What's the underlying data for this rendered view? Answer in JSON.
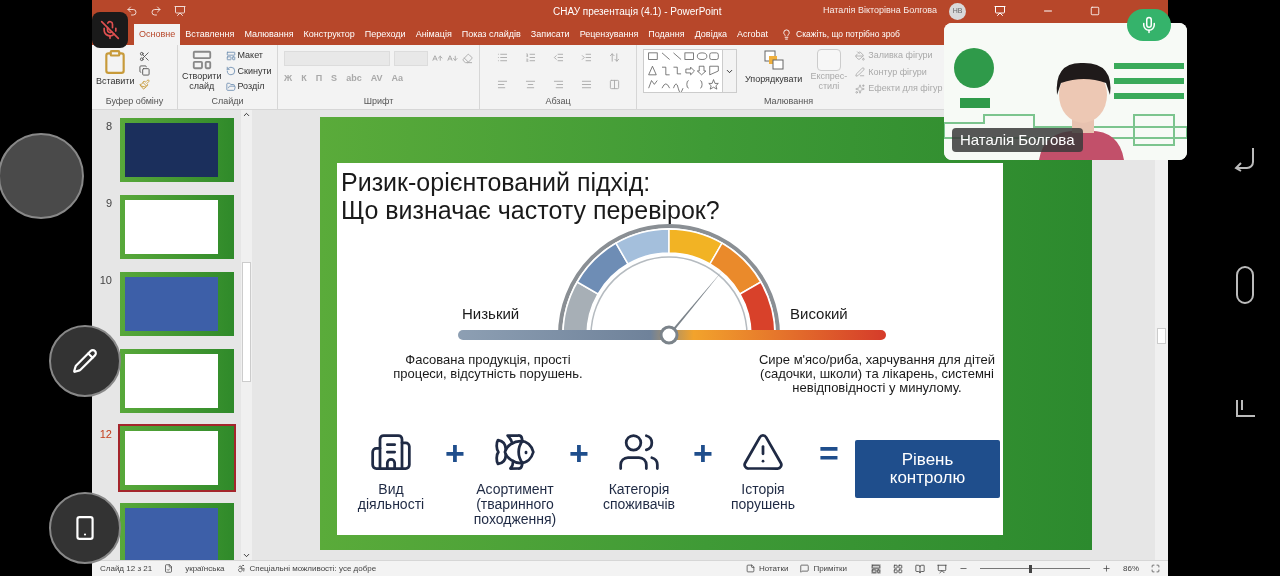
{
  "window": {
    "title": "СНАУ презентація (4.1)  -  PowerPoint",
    "user": "Наталія Вікторівна Болгова",
    "user_initials": "НВ"
  },
  "call": {
    "muted": true,
    "speaker_name": "Наталія Болгова"
  },
  "tabs": [
    {
      "label": "Основне",
      "selected": true
    },
    {
      "label": "Вставлення",
      "selected": false
    },
    {
      "label": "Малювання",
      "selected": false
    },
    {
      "label": "Конструктор",
      "selected": false
    },
    {
      "label": "Переходи",
      "selected": false
    },
    {
      "label": "Анімація",
      "selected": false
    },
    {
      "label": "Показ слайдів",
      "selected": false
    },
    {
      "label": "Записати",
      "selected": false
    },
    {
      "label": "Рецензування",
      "selected": false
    },
    {
      "label": "Подання",
      "selected": false
    },
    {
      "label": "Довідка",
      "selected": false
    },
    {
      "label": "Acrobat",
      "selected": false
    }
  ],
  "tell_me": "Скажіть, що потрібно зроб",
  "ribbon": {
    "clipboard": {
      "label": "Буфер обміну",
      "paste": "Вставити"
    },
    "slides": {
      "label": "Слайди",
      "new_slide": [
        "Створити",
        "слайд"
      ],
      "items": [
        "Макет",
        "Скинути",
        "Розділ"
      ]
    },
    "font": {
      "label": "Шрифт",
      "disabled": true,
      "format_buttons": [
        "Ж",
        "К",
        "П",
        "S",
        "abc",
        "AV",
        "Aa"
      ]
    },
    "paragraph": {
      "label": "Абзац",
      "disabled": true
    },
    "drawing": {
      "label": "Малювання",
      "arrange": "Упорядкувати",
      "quick_styles": {
        "lines": [
          "Експрес-",
          "стилі"
        ],
        "disabled": true
      },
      "shape_items": [
        {
          "label": "Заливка фігури",
          "disabled": true
        },
        {
          "label": "Контур фігури",
          "disabled": true
        },
        {
          "label": "Ефекти для фігур",
          "disabled": true
        }
      ]
    }
  },
  "thumbnails": [
    {
      "number": "8",
      "selected": false,
      "kind": "dark"
    },
    {
      "number": "9",
      "selected": false,
      "kind": "white"
    },
    {
      "number": "10",
      "selected": false,
      "kind": "blue"
    },
    {
      "selected": false,
      "kind": "white"
    },
    {
      "number": "12",
      "selected": true,
      "kind": "white"
    },
    {
      "selected": false,
      "kind": "blue"
    }
  ],
  "slide": {
    "title_lines": [
      "Ризик-орієнтований підхід:",
      "Що визначає частоту перевірок?"
    ],
    "low_label": "Низький",
    "high_label": "Високий",
    "low_description": "Фасована продукція, прості процеси, відсутність порушень.",
    "high_description": "Сире м'ясо/риба, харчування для дітей (садочки, школи) та лікарень, системні невідповідності у минулому.",
    "factors": [
      {
        "kind": "building",
        "lines": [
          "Вид",
          "діяльності"
        ]
      },
      {
        "kind": "food",
        "lines": [
          "Асортимент",
          "(тваринного",
          "походження)"
        ]
      },
      {
        "kind": "people",
        "lines": [
          "Категорія",
          "споживачів"
        ]
      },
      {
        "kind": "history",
        "lines": [
          "Історія",
          "порушень"
        ]
      }
    ],
    "plus": "+",
    "equals": "=",
    "result": [
      "Рівень",
      "контролю"
    ]
  },
  "status_bar": {
    "slide": "Слайд 12 з 21",
    "language": "українська",
    "accessibility": "Спеціальні можливості: усе добре",
    "notes": "Нотатки",
    "comments": "Примітки",
    "zoom": "86%",
    "zoom_level": {
      "level": 0.46
    }
  }
}
